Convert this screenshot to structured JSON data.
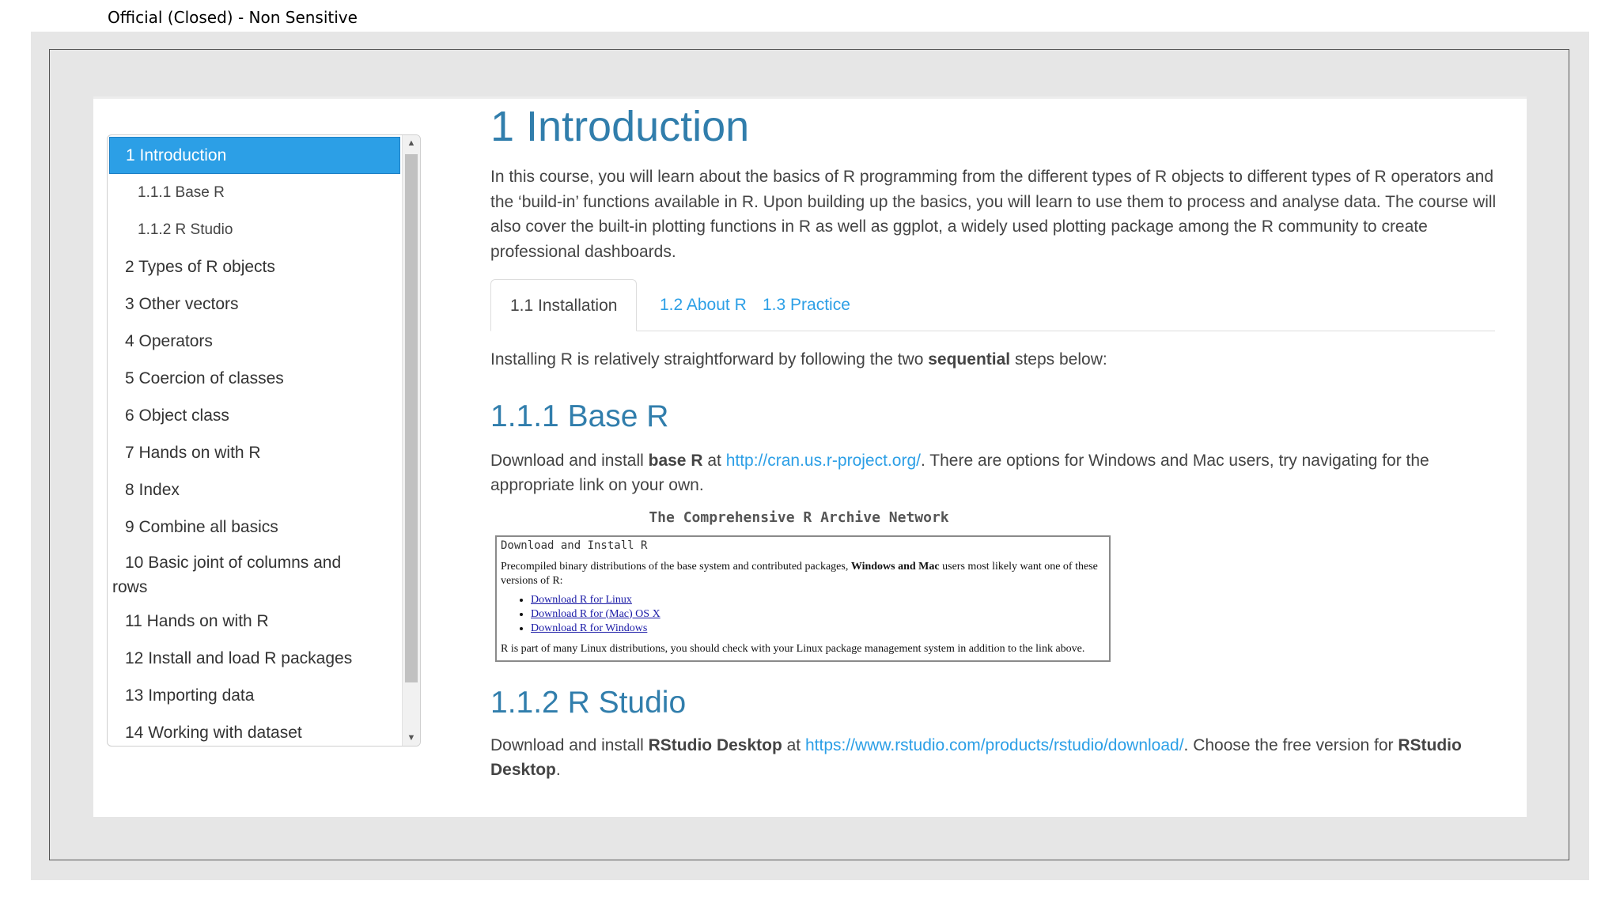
{
  "classification": "Official (Closed) - Non Sensitive",
  "toc": {
    "items": [
      {
        "label": "1 Introduction"
      },
      {
        "label": "1.1.1 Base R"
      },
      {
        "label": "1.1.2 R Studio"
      },
      {
        "label": "2 Types of R objects"
      },
      {
        "label": "3 Other vectors"
      },
      {
        "label": "4 Operators"
      },
      {
        "label": "5 Coercion of classes"
      },
      {
        "label": "6 Object class"
      },
      {
        "label": "7 Hands on with R"
      },
      {
        "label": "8 Index"
      },
      {
        "label": "9 Combine all basics"
      },
      {
        "label": "10 Basic joint of columns and",
        "label_rest": "rows"
      },
      {
        "label": "11 Hands on with R"
      },
      {
        "label": "12 Install and load R packages"
      },
      {
        "label": "13 Importing data"
      },
      {
        "label": "14 Working with dataset"
      }
    ],
    "active_index": 0
  },
  "main": {
    "title": "1 Introduction",
    "intro": "In this course, you will learn about the basics of R programming from the different types of R objects to different types of R operators and the ‘build-in’ functions available in R. Upon building up the basics, you will learn to use them to process and analyse data. The course will also cover the built-in plotting functions in R as well as ggplot, a widely used plotting package among the R community to create professional dashboards.",
    "tabs": [
      {
        "label": "1.1 Installation"
      },
      {
        "label": "1.2 About R"
      },
      {
        "label": "1.3 Practice"
      }
    ],
    "install_lead_a": "Installing R is relatively straightforward by following the two ",
    "install_lead_bold": "sequential",
    "install_lead_b": " steps below:",
    "base_r": {
      "heading": "1.1.1 Base R",
      "text_a": "Download and install ",
      "text_bold": "base R",
      "text_b": " at ",
      "link": "http://cran.us.r-project.org/",
      "text_c": ". There are options for Windows and Mac users, try navigating for the appropriate link on your own."
    },
    "cran": {
      "title": "The Comprehensive R Archive Network",
      "box_header": "Download and Install R",
      "para_a": "Precompiled binary distributions of the base system and contributed packages, ",
      "para_bold": "Windows and Mac",
      "para_b": " users most likely want one of these versions of R:",
      "links": [
        "Download R for Linux",
        "Download R for (Mac) OS X",
        "Download R for Windows"
      ],
      "footer": "R is part of many Linux distributions, you should check with your Linux package management system in addition to the link above."
    },
    "rstudio": {
      "heading": "1.1.2 R Studio",
      "text_a": "Download and install ",
      "text_bold": "RStudio Desktop",
      "text_b": " at ",
      "link": "https://www.rstudio.com/products/rstudio/download/",
      "text_c": ". Choose the free version for ",
      "text_bold2": "RStudio Desktop",
      "text_d": "."
    }
  }
}
